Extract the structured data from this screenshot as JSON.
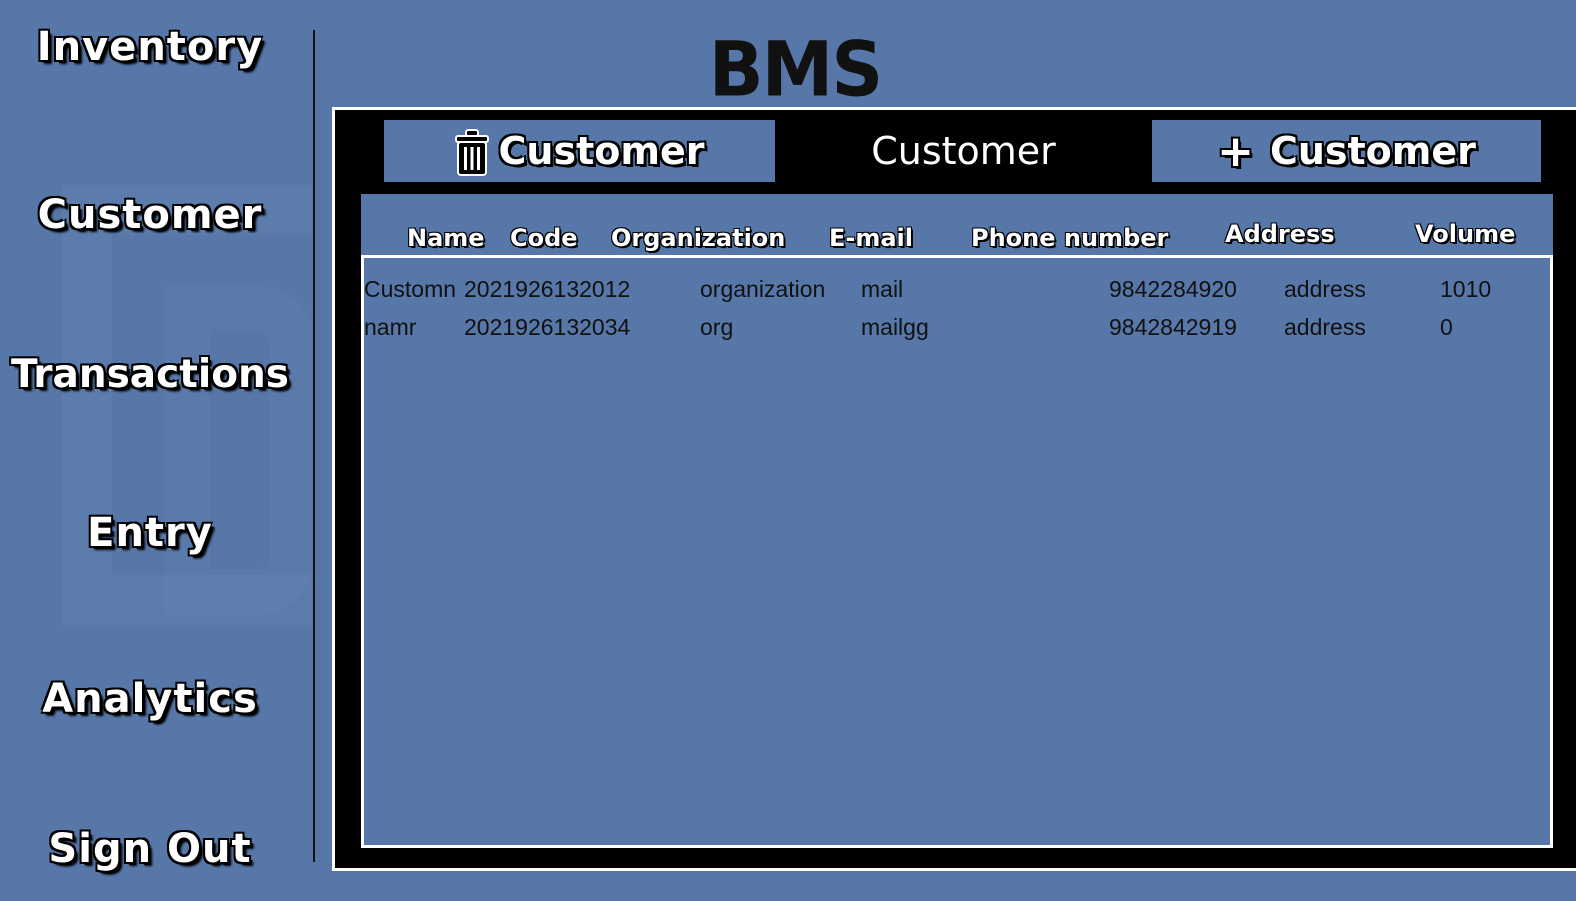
{
  "app": {
    "logo": "BMS"
  },
  "sidebar": {
    "items": [
      {
        "label": "Inventory"
      },
      {
        "label": "Customer"
      },
      {
        "label": "Transactions"
      },
      {
        "label": "Entry"
      },
      {
        "label": "Analytics"
      },
      {
        "label": "Sign Out"
      }
    ]
  },
  "tabs": {
    "delete_label": "Customer",
    "view_label": "Customer",
    "add_label": "Customer",
    "add_prefix": "+"
  },
  "table": {
    "columns": [
      "Name",
      "Code",
      "Organization",
      "E-mail",
      "Phone number",
      "Address",
      "Volume"
    ],
    "rows": [
      {
        "name": "Customn",
        "code": "2021926132012",
        "organization": "organization",
        "email": "mail",
        "phone": "9842284920",
        "address": "address",
        "volume": "1010"
      },
      {
        "name": "namr",
        "code": "2021926132034",
        "organization": "org",
        "email": "mailgg",
        "phone": "9842842919",
        "address": "address",
        "volume": "0"
      }
    ]
  },
  "colors": {
    "background": "#5677a8",
    "panel": "#000000",
    "text_light": "#ffffff",
    "text_dark": "#111111"
  },
  "icons": {
    "delete_tab": "trash-icon",
    "add_tab": "plus-icon"
  }
}
